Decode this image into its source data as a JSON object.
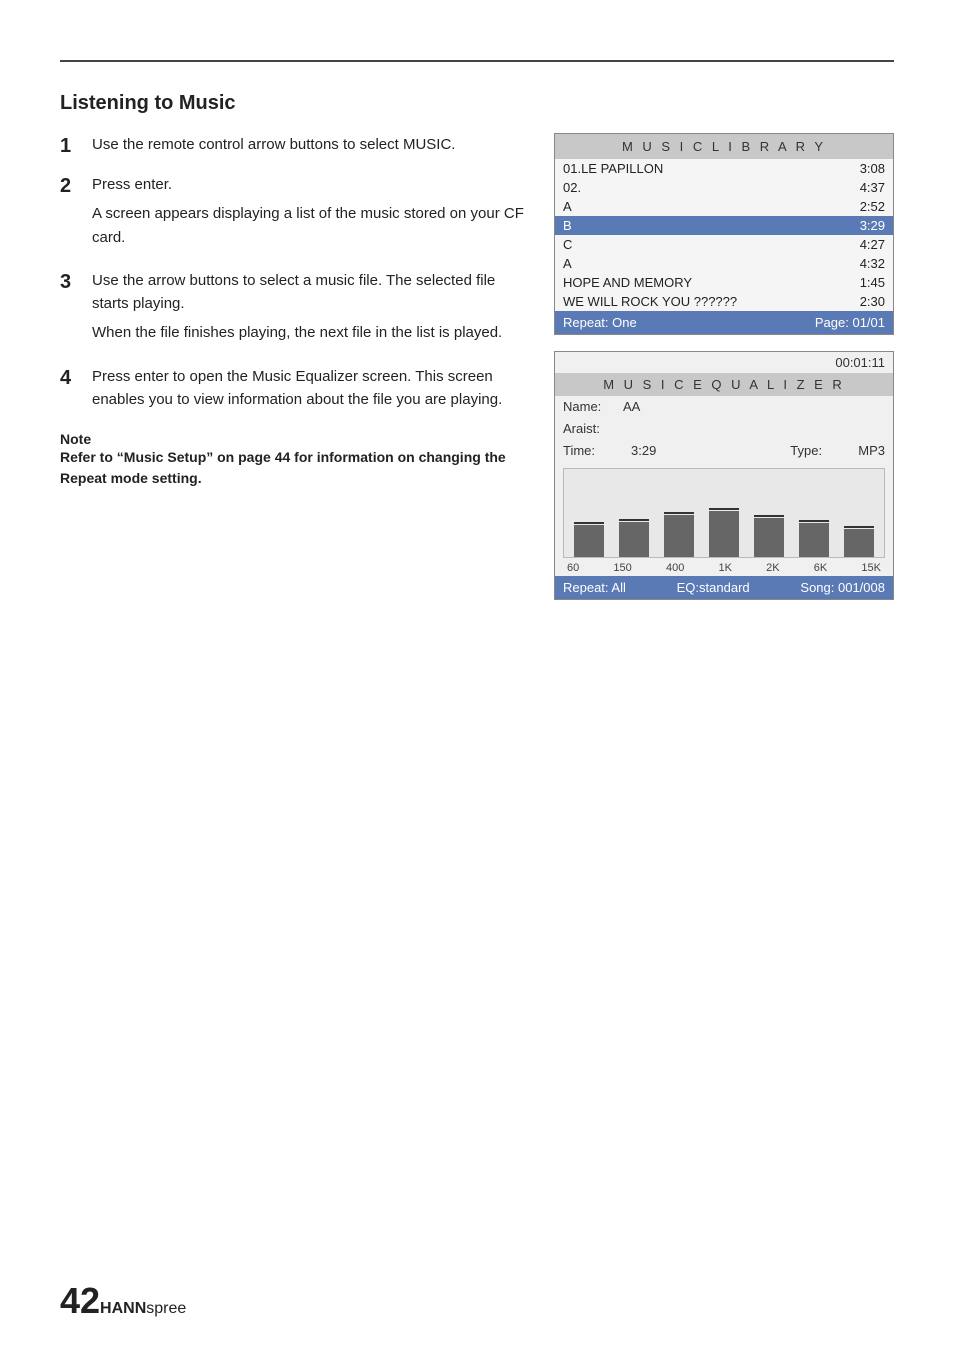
{
  "page": {
    "section_title": "Listening to Music",
    "steps": [
      {
        "number": "1",
        "text": "Use the remote control arrow buttons to select MUSIC."
      },
      {
        "number": "2",
        "lines": [
          "Press enter.",
          "A screen appears displaying a list of the music stored on your CF card."
        ]
      },
      {
        "number": "3",
        "lines": [
          "Use the arrow buttons to select a music file. The selected file starts playing.",
          "When the file finishes playing, the next file in the list is played."
        ]
      },
      {
        "number": "4",
        "lines": [
          "Press enter to open the Music Equalizer screen. This screen enables you to view information about the file you are playing."
        ]
      }
    ],
    "note_label": "Note",
    "note_text": "Refer to “Music Setup” on page 44 for information on changing the Repeat mode setting."
  },
  "music_library": {
    "header": "M U S I C   L I B R A R Y",
    "tracks": [
      {
        "name": "01.LE PAPILLON",
        "duration": "3:08"
      },
      {
        "name": "02.",
        "duration": "4:37"
      },
      {
        "name": "A",
        "duration": "2:52"
      },
      {
        "name": "B",
        "duration": "3:29",
        "selected": true
      },
      {
        "name": "C",
        "duration": "4:27"
      },
      {
        "name": "A",
        "duration": "4:32"
      },
      {
        "name": "HOPE AND MEMORY",
        "duration": "1:45"
      },
      {
        "name": "WE WILL ROCK YOU ??????",
        "duration": "2:30"
      }
    ],
    "repeat": "Repeat: One",
    "page": "Page: 01/01"
  },
  "music_equalizer": {
    "time": "00:01:11",
    "header": "M U S I C   E Q U A L I Z E R",
    "name_label": "Name:",
    "name_value": "AA",
    "artist_label": "Araist:",
    "artist_value": "",
    "time_label": "Time:",
    "time_value": "3:29",
    "type_label": "Type:",
    "type_value": "MP3",
    "eq_labels": [
      "60",
      "150",
      "400",
      "1K",
      "2K",
      "6K",
      "15K"
    ],
    "eq_bars": [
      45,
      50,
      60,
      65,
      55,
      48,
      40
    ],
    "eq_markers": [
      55,
      60,
      50,
      70,
      65,
      55,
      45
    ],
    "repeat": "Repeat: All",
    "eq_mode": "EQ:standard",
    "song": "Song: 001/008"
  },
  "branding": {
    "number": "42",
    "brand_hann": "HANN",
    "brand_spree": "spree"
  }
}
